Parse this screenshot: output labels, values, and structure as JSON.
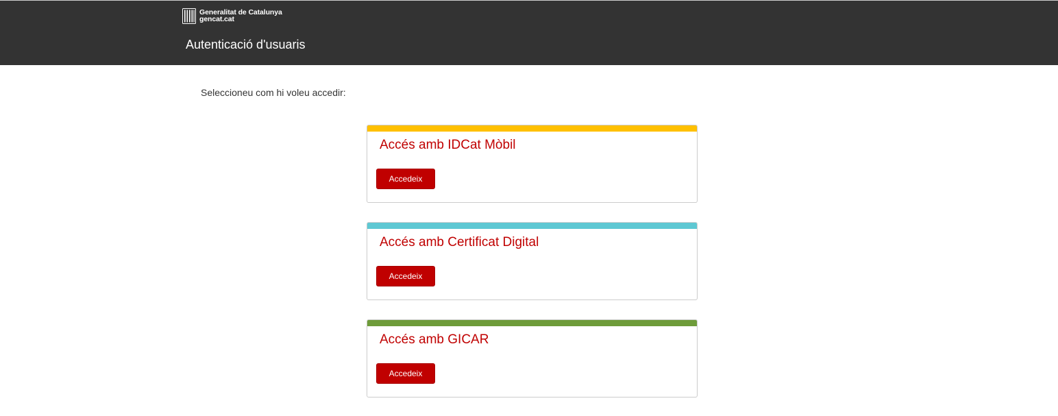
{
  "header": {
    "brand": {
      "line1": "Generalitat de Catalunya",
      "line2": "gencat.cat",
      "logo_icon": "generalitat-logo-icon"
    },
    "title": "Autenticació d'usuaris"
  },
  "main": {
    "intro": "Seleccioneu com hi voleu accedir:",
    "options": [
      {
        "title": "Accés amb IDCat Mòbil",
        "button_label": "Accedeix",
        "accent_color": "#ffc000"
      },
      {
        "title": "Accés amb Certificat Digital",
        "button_label": "Accedeix",
        "accent_color": "#5ec8d3"
      },
      {
        "title": "Accés amb GICAR",
        "button_label": "Accedeix",
        "accent_color": "#6e9c3a"
      }
    ]
  },
  "colors": {
    "header_bg": "#333333",
    "title_red": "#c00000",
    "button_red": "#c00000"
  }
}
